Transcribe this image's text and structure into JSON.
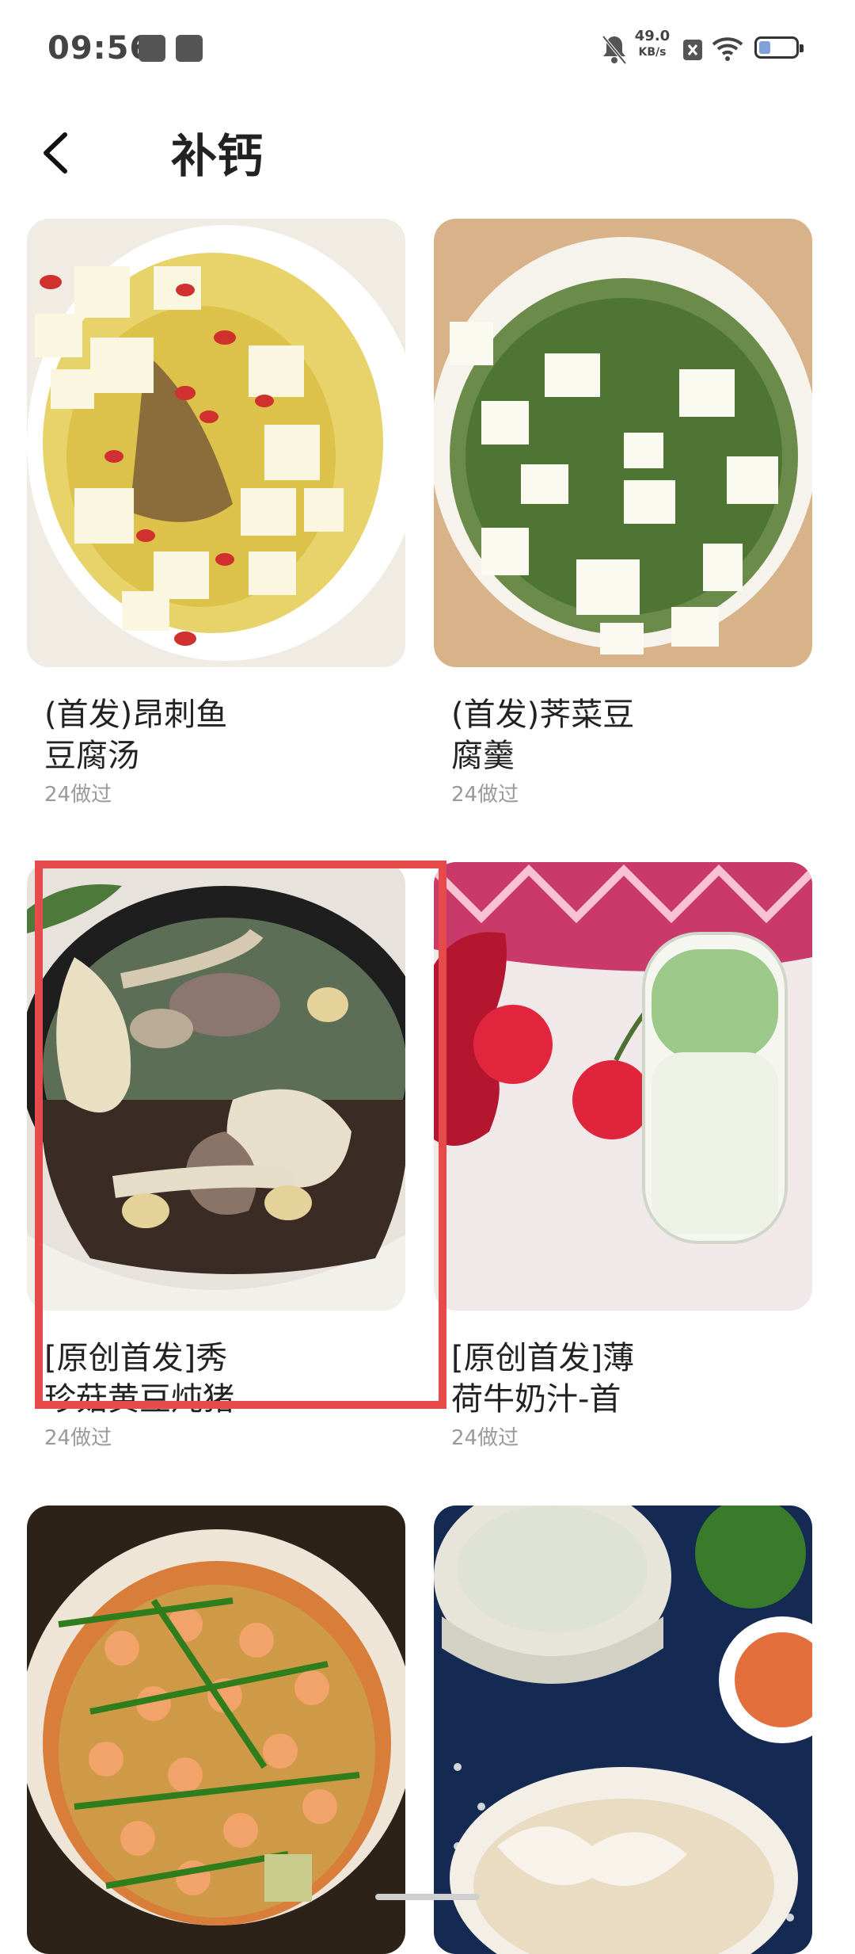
{
  "status_bar": {
    "time": "09:56",
    "speed_value": "49.0",
    "speed_unit": "KB/s"
  },
  "header": {
    "title": "补钙"
  },
  "recipes": [
    {
      "name": "(首发)昂刺鱼\n豆腐汤",
      "count": "24做过"
    },
    {
      "name": "(首发)荠菜豆\n腐羹",
      "count": "24做过"
    },
    {
      "name": "[原创首发]秀\n珍菇黄豆炖猪",
      "count": "24做过"
    },
    {
      "name": "[原创首发]薄\n荷牛奶汁-首",
      "count": "24做过"
    },
    {
      "name": "",
      "count": ""
    },
    {
      "name": "",
      "count": ""
    }
  ],
  "colors": {
    "highlight": "#e64a4a"
  }
}
